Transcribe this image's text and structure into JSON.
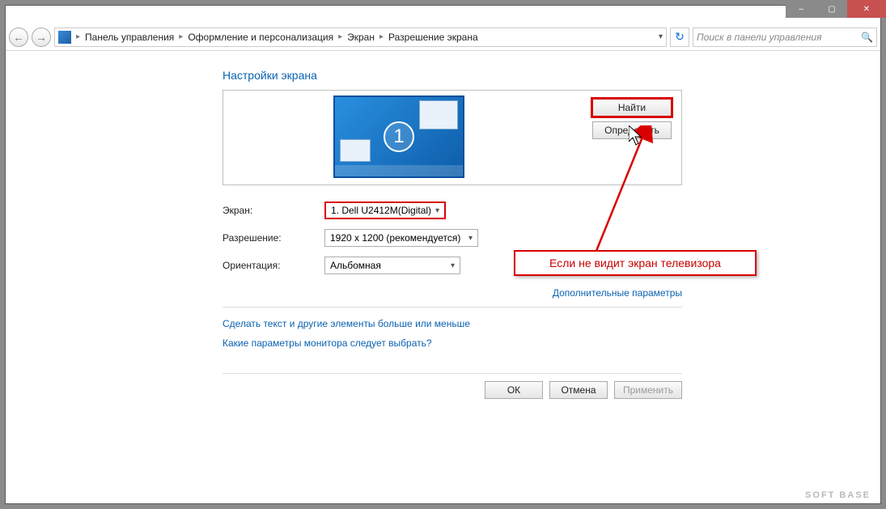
{
  "titlebar": {
    "minimize": "–",
    "maximize": "▢",
    "close": "✕"
  },
  "breadcrumbs": {
    "items": [
      "Панель управления",
      "Оформление и персонализация",
      "Экран",
      "Разрешение экрана"
    ]
  },
  "search": {
    "placeholder": "Поиск в панели управления"
  },
  "page": {
    "title": "Настройки экрана"
  },
  "monitor": {
    "number": "1"
  },
  "buttons": {
    "find": "Найти",
    "identify": "Определить",
    "ok": "ОК",
    "cancel": "Отмена",
    "apply": "Применить"
  },
  "form": {
    "display_label": "Экран:",
    "display_value": "1. Dell U2412M(Digital)",
    "resolution_label": "Разрешение:",
    "resolution_value": "1920 x 1200 (рекомендуется)",
    "orientation_label": "Ориентация:",
    "orientation_value": "Альбомная"
  },
  "links": {
    "advanced": "Дополнительные параметры",
    "text_size": "Сделать текст и другие элементы больше или меньше",
    "which_settings": "Какие параметры монитора следует выбрать?"
  },
  "callout": {
    "text": "Если не видит экран телевизора"
  },
  "watermark": "SOFT BASE"
}
